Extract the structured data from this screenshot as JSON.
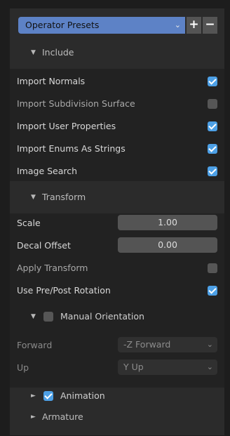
{
  "presets": {
    "label": "Operator Presets",
    "add": "+",
    "remove": "−"
  },
  "include": {
    "header": "Include",
    "items": [
      {
        "label": "Import Normals",
        "checked": true
      },
      {
        "label": "Import Subdivision Surface",
        "checked": false
      },
      {
        "label": "Import User Properties",
        "checked": true
      },
      {
        "label": "Import Enums As Strings",
        "checked": true
      },
      {
        "label": "Image Search",
        "checked": true
      }
    ]
  },
  "transform": {
    "header": "Transform",
    "scale_label": "Scale",
    "scale_value": "1.00",
    "decal_label": "Decal Offset",
    "decal_value": "0.00",
    "apply_label": "Apply Transform",
    "apply_checked": false,
    "rotation_label": "Use Pre/Post Rotation",
    "rotation_checked": true,
    "manual": {
      "label": "Manual Orientation",
      "checked": false,
      "forward_label": "Forward",
      "forward_value": "-Z Forward",
      "up_label": "Up",
      "up_value": "Y Up"
    }
  },
  "animation": {
    "label": "Animation",
    "checked": true
  },
  "armature": {
    "label": "Armature"
  },
  "icons": {
    "expanded": "▼",
    "collapsed": "►",
    "chevron": "⌄"
  },
  "colors": {
    "accent": "#4da0e6",
    "preset_bg": "#5d82c6"
  }
}
